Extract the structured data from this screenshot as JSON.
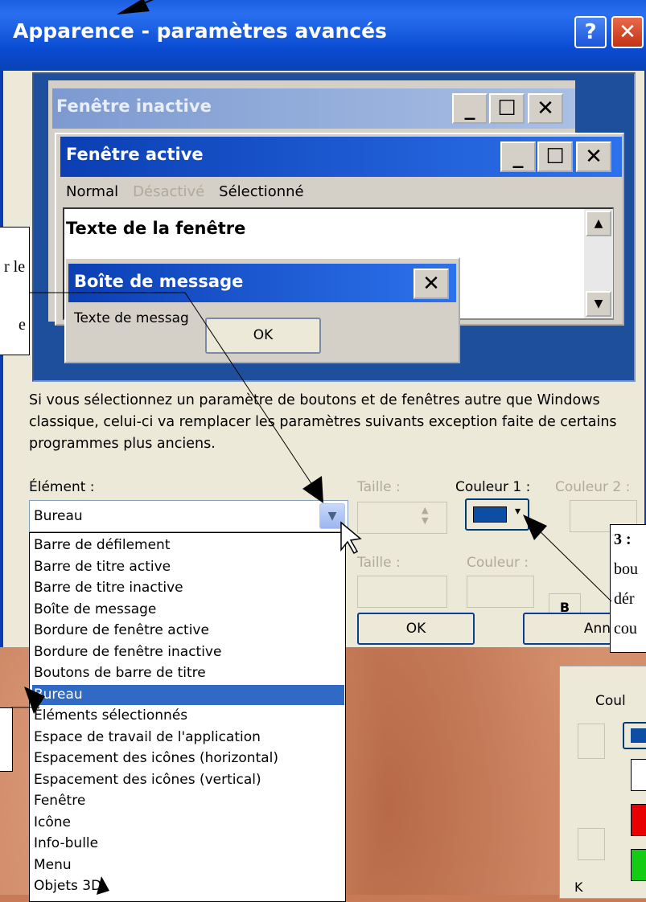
{
  "window": {
    "title": "Apparence - paramètres avancés",
    "help_glyph": "?",
    "close_glyph": "✕"
  },
  "preview": {
    "inactive_title": "Fenêtre inactive",
    "active_title": "Fenêtre active",
    "menu": [
      "Normal",
      "Désactivé",
      "Sélectionné"
    ],
    "window_text": "Texte de la fenêtre",
    "message_title": "Boîte de message",
    "message_text": "Texte de messag",
    "ok_label": "OK",
    "min_glyph": "_",
    "max_glyph": "☐",
    "close_glyph": "✕"
  },
  "description": "Si vous sélectionnez un paramètre de boutons et de fenêtres autre que Windows classique, celui-ci va remplacer les paramètres suivants exception faite de certains programmes plus anciens.",
  "element": {
    "label": "Élément :",
    "selected": "Bureau",
    "options": [
      "Barre de défilement",
      "Barre de titre active",
      "Barre de titre inactive",
      "Boîte de message",
      "Bordure de fenêtre active",
      "Bordure de fenêtre inactive",
      "Boutons de barre de titre",
      "Bureau",
      "Éléments sélectionnés",
      "Espace de travail de l'application",
      "Espacement des icônes (horizontal)",
      "Espacement des icônes (vertical)",
      "Fenêtre",
      "Icône",
      "Info-bulle",
      "Menu",
      "Objets 3D"
    ],
    "selected_index": 7
  },
  "size_label": "Taille :",
  "color1_label": "Couleur 1 :",
  "color2_label": "Couleur 2 :",
  "font_size_label": "Taille :",
  "font_color_label": "Couleur :",
  "bold_label": "B",
  "ok_label": "OK",
  "cancel_label": "Annuler",
  "annotations": {
    "left_box": [
      "r le",
      "e"
    ],
    "right_box": [
      "3 :",
      "bou",
      "dér",
      "cou"
    ],
    "palette_label": "Coul",
    "palette_k": "K"
  },
  "colors": {
    "title_blue": "#0a4bd2",
    "selection": "#316ac5",
    "swatch": "#0b4ea4",
    "dialog_bg": "#ece9d8"
  }
}
